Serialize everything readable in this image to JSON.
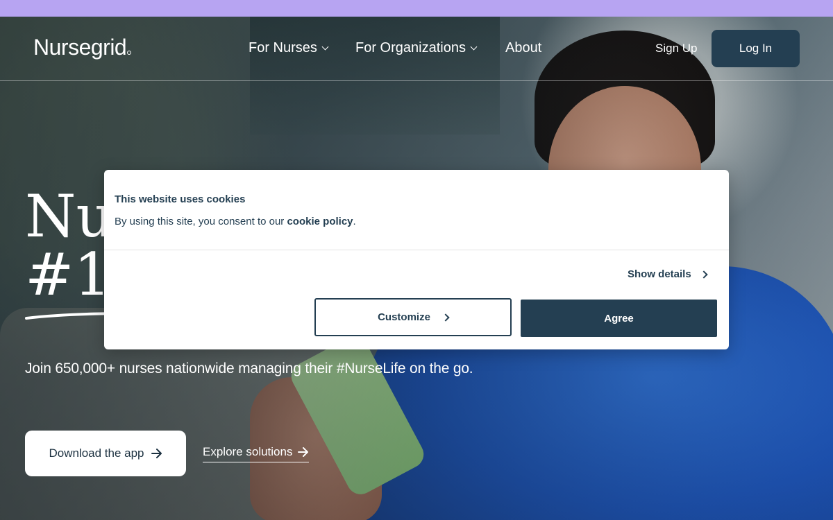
{
  "colors": {
    "top_banner": "#b7a4f2",
    "brand_navy": "#243f52",
    "white": "#ffffff"
  },
  "nav": {
    "logo": "Nursegrid",
    "links": [
      {
        "label": "For Nurses",
        "icon": "chevron-down-icon"
      },
      {
        "label": "For Organizations",
        "icon": "chevron-down-icon"
      },
      {
        "label": "About"
      }
    ],
    "sign_up": "Sign Up",
    "log_in": "Log In"
  },
  "hero": {
    "title_visible": "Nu\n#1 a",
    "subtitle": "Join 650,000+ nurses nationwide managing their #NurseLife on the go.",
    "download_button": "Download the app",
    "explore_link": "Explore solutions"
  },
  "cookie_banner": {
    "title": "This website uses cookies",
    "text_prefix": "By using this site, you consent to our ",
    "policy_link": "cookie policy",
    "text_suffix": ".",
    "show_details": "Show details",
    "customize_button": "Customize",
    "agree_button": "Agree"
  }
}
